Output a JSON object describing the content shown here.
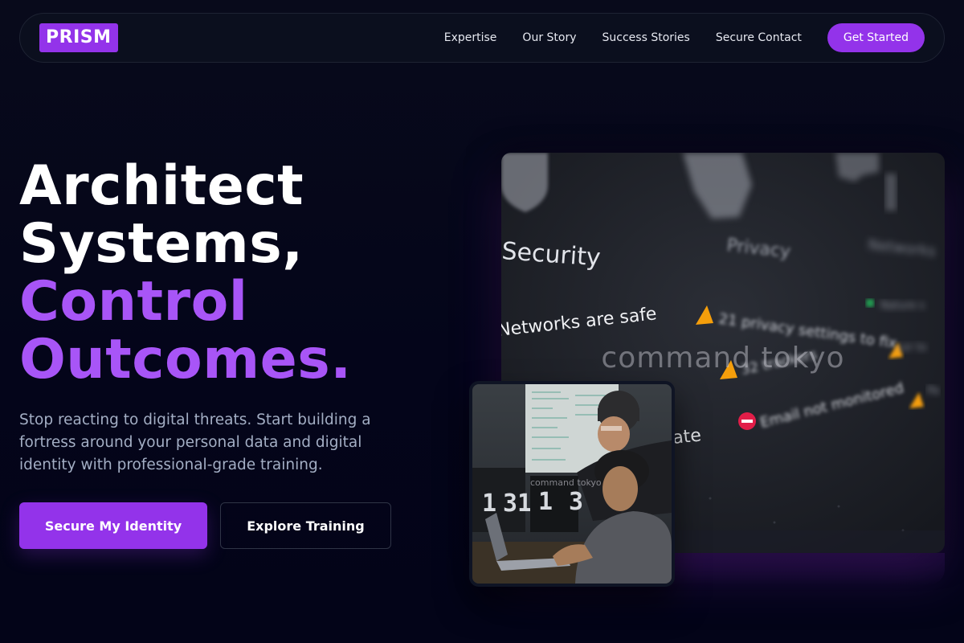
{
  "brand": {
    "logo_text": "PRISM",
    "accent": "#9333ea",
    "accent_light": "#a855f7"
  },
  "nav": {
    "links": [
      "Expertise",
      "Our Story",
      "Success Stories",
      "Secure Contact"
    ],
    "cta": "Get Started"
  },
  "hero": {
    "title_lines": [
      "Architect",
      "Systems,",
      "Control",
      "Outcomes."
    ],
    "description": "Stop reacting to digital threats. Start building a fortress around your personal data and digital identity with professional-grade training.",
    "primary_button": "Secure My Identity",
    "secondary_button": "Explore Training"
  },
  "main_image": {
    "screen_texts": [
      "Security",
      "Privacy",
      "Networks are safe",
      "21 privacy settings to fix",
      "32 trackers",
      "Email not monitored",
      "ate"
    ],
    "watermark": "command tokyo"
  },
  "inset_image": {
    "watermark": "command tokyo",
    "monitor_digits": [
      "1",
      "31",
      "1",
      "3"
    ]
  }
}
